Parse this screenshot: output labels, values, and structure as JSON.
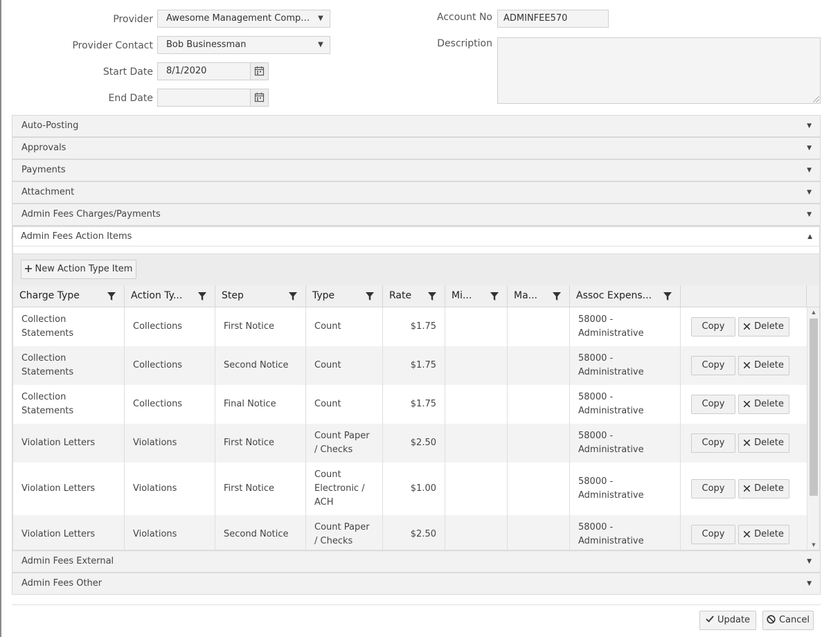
{
  "form": {
    "provider": {
      "label": "Provider",
      "value": "Awesome Management Company"
    },
    "provider_contact": {
      "label": "Provider Contact",
      "value": "Bob Businessman"
    },
    "start_date": {
      "label": "Start Date",
      "value": "8/1/2020"
    },
    "end_date": {
      "label": "End Date",
      "value": ""
    },
    "account_no": {
      "label": "Account No",
      "value": "ADMINFEE570"
    },
    "description": {
      "label": "Description",
      "value": ""
    }
  },
  "panels_top": [
    "Auto-Posting",
    "Approvals",
    "Payments",
    "Attachment",
    "Admin Fees Charges/Payments"
  ],
  "action_items": {
    "title": "Admin Fees Action Items",
    "new_button": "New Action Type Item",
    "columns": [
      "Charge Type",
      "Action Ty...",
      "Step",
      "Type",
      "Rate",
      "Mi...",
      "Ma...",
      "Assoc Expens..."
    ],
    "copy_label": "Copy",
    "delete_label": "Delete",
    "rows": [
      {
        "charge_type": "Collection Statements",
        "action_type": "Collections",
        "step": "First Notice",
        "type": "Count",
        "rate": "$1.75",
        "min": "",
        "max": "",
        "assoc_expense": "58000 - Administrative"
      },
      {
        "charge_type": "Collection Statements",
        "action_type": "Collections",
        "step": "Second Notice",
        "type": "Count",
        "rate": "$1.75",
        "min": "",
        "max": "",
        "assoc_expense": "58000 - Administrative"
      },
      {
        "charge_type": "Collection Statements",
        "action_type": "Collections",
        "step": "Final Notice",
        "type": "Count",
        "rate": "$1.75",
        "min": "",
        "max": "",
        "assoc_expense": "58000 - Administrative"
      },
      {
        "charge_type": "Violation Letters",
        "action_type": "Violations",
        "step": "First Notice",
        "type": "Count Paper / Checks",
        "rate": "$2.50",
        "min": "",
        "max": "",
        "assoc_expense": "58000 - Administrative"
      },
      {
        "charge_type": "Violation Letters",
        "action_type": "Violations",
        "step": "First Notice",
        "type": "Count Electronic / ACH",
        "rate": "$1.00",
        "min": "",
        "max": "",
        "assoc_expense": "58000 - Administrative"
      },
      {
        "charge_type": "Violation Letters",
        "action_type": "Violations",
        "step": "Second Notice",
        "type": "Count Paper / Checks",
        "rate": "$2.50",
        "min": "",
        "max": "",
        "assoc_expense": "58000 - Administrative"
      }
    ]
  },
  "panels_bottom": [
    "Admin Fees External",
    "Admin Fees Other"
  ],
  "footer": {
    "update_label": "Update",
    "cancel_label": "Cancel"
  },
  "icons": {
    "select_arrow": "caret-down-icon",
    "calendar": "calendar-icon",
    "filter": "filter-icon",
    "plus": "plus-icon",
    "delete": "x-icon",
    "update": "check-icon",
    "cancel": "ban-icon",
    "expand": "caret-down-icon",
    "collapse": "caret-up-icon"
  }
}
